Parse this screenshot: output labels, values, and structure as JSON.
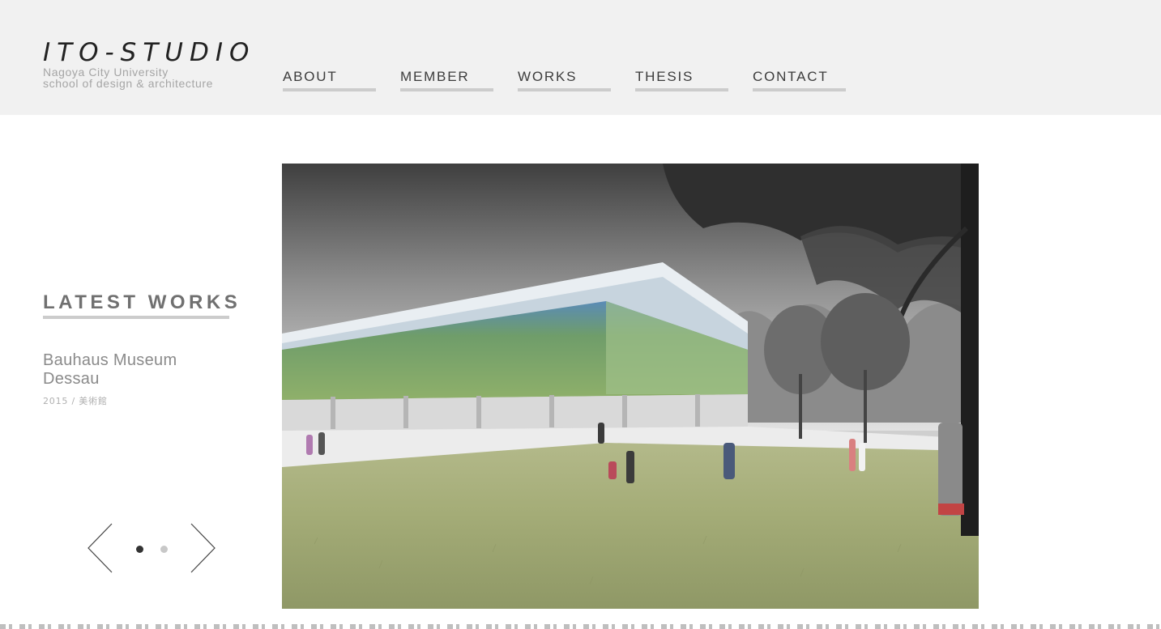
{
  "brand": {
    "title": "ITO-STUDIO",
    "subtitle_line1": "Nagoya City University",
    "subtitle_line2": "school of design & architecture"
  },
  "nav": {
    "items": [
      {
        "label": "ABOUT"
      },
      {
        "label": "MEMBER"
      },
      {
        "label": "WORKS"
      },
      {
        "label": "THESIS"
      },
      {
        "label": "CONTACT"
      }
    ]
  },
  "latest": {
    "heading": "LATEST WORKS",
    "work_title_line1": "Bauhaus Museum",
    "work_title_line2": "Dessau",
    "work_meta": "2015 / 美術館"
  },
  "slider": {
    "active_slide": 1,
    "total_slides": 2
  },
  "colors": {
    "header_bg": "#f1f1f1",
    "nav_underline": "#cccccc",
    "heading_text": "#707070",
    "dot_active": "#333333",
    "dot_inactive": "#c8c8c8"
  }
}
